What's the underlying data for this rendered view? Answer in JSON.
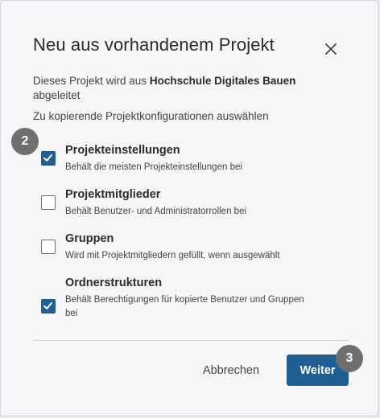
{
  "dialog": {
    "title": "Neu aus vorhandenem Projekt",
    "description_prefix": "Dieses Projekt wird aus",
    "source_project": "Hochschule Digitales Bauen",
    "description_suffix": "abgeleitet",
    "subheading": "Zu kopierende Projektkonfigurationen auswählen",
    "close_icon": "close-icon"
  },
  "options": [
    {
      "label": "Projekteinstellungen",
      "description": "Behält die meisten Projekteinstellungen bei",
      "checked": true
    },
    {
      "label": "Projektmitglieder",
      "description": "Behält Benutzer- und Administratorrollen bei",
      "checked": false
    },
    {
      "label": "Gruppen",
      "description": "Wird mit Projektmitgliedern gefüllt, wenn ausgewählt",
      "checked": false
    },
    {
      "label": "Ordnerstrukturen",
      "description": "Behält Berechtigungen für kopierte Benutzer und Gruppen bei",
      "checked": true
    }
  ],
  "badges": {
    "first": "2",
    "second": "3"
  },
  "footer": {
    "cancel_label": "Abbrechen",
    "next_label": "Weiter"
  },
  "colors": {
    "accent": "#1f5f94",
    "badge": "#6f6f6f",
    "background": "#f6f6f8"
  }
}
